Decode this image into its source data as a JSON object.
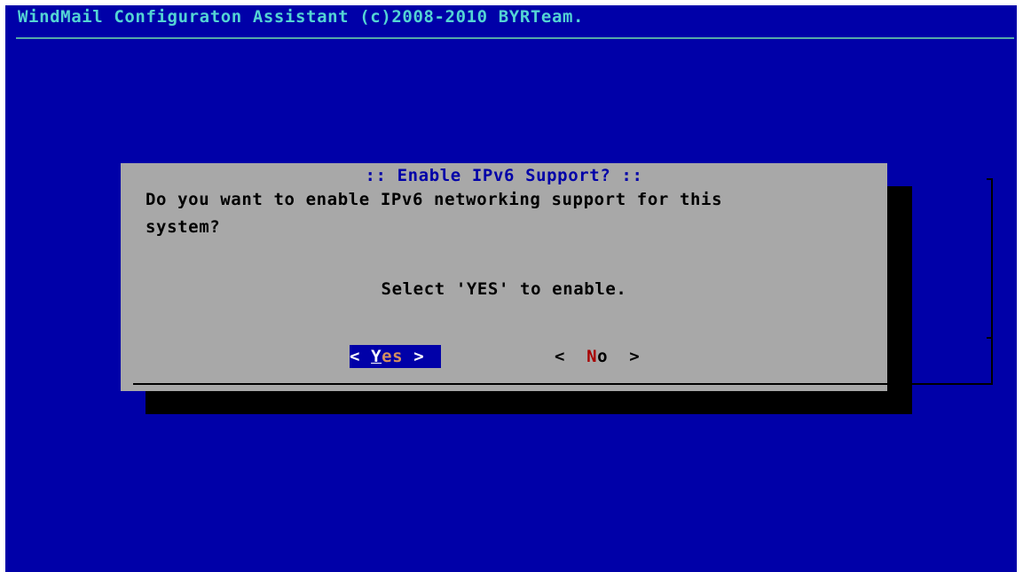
{
  "backtitle": "WindMail Configuraton Assistant (c)2008-2010 BYRTeam.",
  "dialog": {
    "title": ":: Enable IPv6 Support? ::",
    "message": "Do you want to enable IPv6 networking support for this\nsystem?",
    "hint": "Select 'YES' to enable."
  },
  "buttons": {
    "yes": {
      "open": "< ",
      "hotkey": "Y",
      "rest": "es",
      "close": " >",
      "selected": true
    },
    "no": {
      "open": "<  ",
      "hotkey": "N",
      "rest": "o",
      "close": "  >",
      "selected": false
    }
  },
  "colors": {
    "background": "#0000a8",
    "dialog": "#a8a8a8",
    "backtitle": "#54d4d4",
    "hotkey_no": "#a80000"
  }
}
